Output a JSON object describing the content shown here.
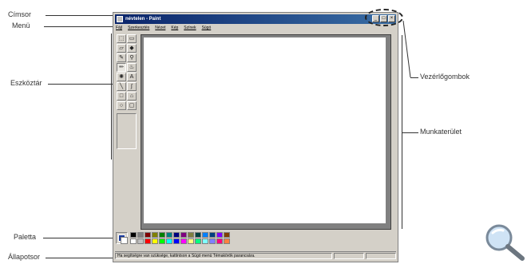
{
  "labels": {
    "cimsor": "Címsor",
    "menu": "Menü",
    "eszkoztar": "Eszköztár",
    "paletta": "Paletta",
    "allapotsor": "Állapotsor",
    "vezerlogombok": "Vezérlőgombok",
    "munkaterulet": "Munkaterület"
  },
  "window": {
    "title": "névtelen - Paint",
    "controls": [
      "_",
      "□",
      "×"
    ],
    "menu_items": [
      "Fájl",
      "Szerkesztés",
      "Nézet",
      "Kép",
      "Színek",
      "Súgó"
    ],
    "status_text": "Ha segítségre van szüksége, kattintson a Súgó menü Témakörök parancsára."
  },
  "tools": [
    {
      "name": "free-select-icon",
      "glyph": "⬚"
    },
    {
      "name": "select-icon",
      "glyph": "▭"
    },
    {
      "name": "eraser-icon",
      "glyph": "▱"
    },
    {
      "name": "fill-icon",
      "glyph": "◆"
    },
    {
      "name": "color-picker-icon",
      "glyph": "✎"
    },
    {
      "name": "magnifier-icon",
      "glyph": "⚲"
    },
    {
      "name": "pencil-icon",
      "glyph": "✏"
    },
    {
      "name": "brush-icon",
      "glyph": "♨"
    },
    {
      "name": "airbrush-icon",
      "glyph": "✺"
    },
    {
      "name": "text-icon",
      "glyph": "A"
    },
    {
      "name": "line-icon",
      "glyph": "╲"
    },
    {
      "name": "curve-icon",
      "glyph": "∫"
    },
    {
      "name": "rectangle-icon",
      "glyph": "□"
    },
    {
      "name": "polygon-icon",
      "glyph": "⌂"
    },
    {
      "name": "ellipse-icon",
      "glyph": "○"
    },
    {
      "name": "rounded-rect-icon",
      "glyph": "▢"
    }
  ],
  "palette_colors": [
    "#000000",
    "#808080",
    "#800000",
    "#808000",
    "#008000",
    "#008080",
    "#000080",
    "#800080",
    "#808040",
    "#004040",
    "#0080ff",
    "#004080",
    "#8000ff",
    "#804000",
    "#ffffff",
    "#c0c0c0",
    "#ff0000",
    "#ffff00",
    "#00ff00",
    "#00ffff",
    "#0000ff",
    "#ff00ff",
    "#ffff80",
    "#00ff80",
    "#80ffff",
    "#8080ff",
    "#ff0080",
    "#ff8040"
  ]
}
